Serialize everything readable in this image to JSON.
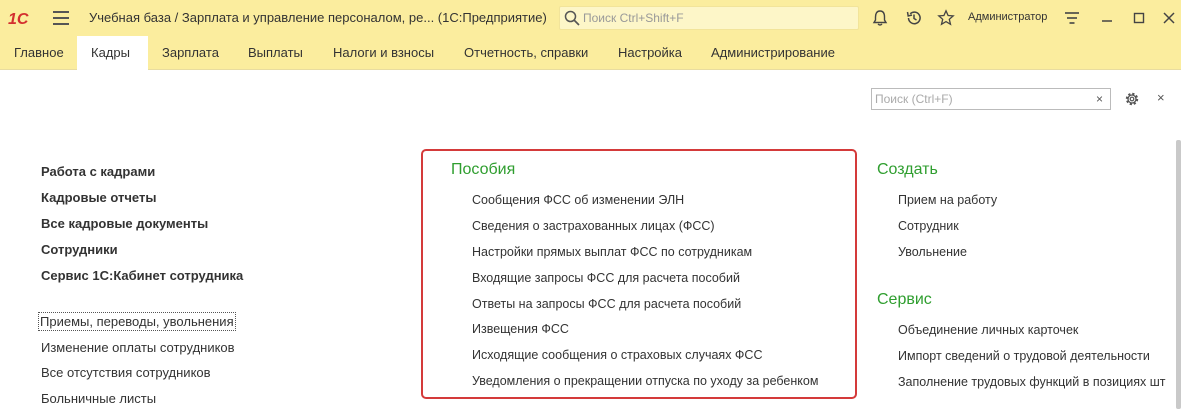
{
  "titlebar": {
    "app_title": "Учебная база / Зарплата и управление персоналом, ре...  (1С:Предприятие)",
    "search_placeholder": "Поиск Ctrl+Shift+F",
    "user": "Администратор",
    "logo_text": "1С",
    "icons": [
      "menu-icon",
      "search-icon",
      "bell-icon",
      "history-icon",
      "star-icon",
      "settings-lines-icon",
      "minimize-icon",
      "maximize-icon",
      "close-icon"
    ]
  },
  "menu": {
    "items": [
      "Главное",
      "Кадры",
      "Зарплата",
      "Выплаты",
      "Налоги и взносы",
      "Отчетность, справки",
      "Настройка",
      "Администрирование"
    ],
    "active": "Кадры"
  },
  "content_search": {
    "placeholder": "Поиск (Ctrl+F)",
    "clear": "×",
    "close": "×"
  },
  "left": {
    "main_links": [
      "Работа с кадрами",
      "Кадровые отчеты",
      "Все кадровые документы",
      "Сотрудники",
      "Сервис 1С:Кабинет сотрудника"
    ],
    "links": [
      "Приемы, переводы, увольнения",
      "Изменение оплаты сотрудников",
      "Все отсутствия сотрудников",
      "Больничные листы"
    ]
  },
  "posobiya": {
    "title": "Пособия",
    "links": [
      "Сообщения ФСС об изменении ЭЛН",
      "Сведения о застрахованных лицах (ФСС)",
      "Настройки прямых выплат ФСС по сотрудникам",
      "Входящие запросы ФСС для расчета пособий",
      "Ответы на запросы ФСС для расчета пособий",
      "Извещения ФСС",
      "Исходящие сообщения о страховых случаях ФСС",
      "Уведомления о прекращении отпуска по уходу за ребенком"
    ]
  },
  "create": {
    "title": "Создать",
    "links": [
      "Прием на работу",
      "Сотрудник",
      "Увольнение"
    ]
  },
  "service": {
    "title": "Сервис",
    "links": [
      "Объединение личных карточек",
      "Импорт сведений о трудовой деятельности",
      "Заполнение трудовых функций в позициях шт"
    ]
  },
  "colors": {
    "header_bg": "#fbed9e",
    "section_title": "#2f9e2f",
    "highlight_border": "#d43a3a",
    "logo_red": "#d32f2f"
  }
}
